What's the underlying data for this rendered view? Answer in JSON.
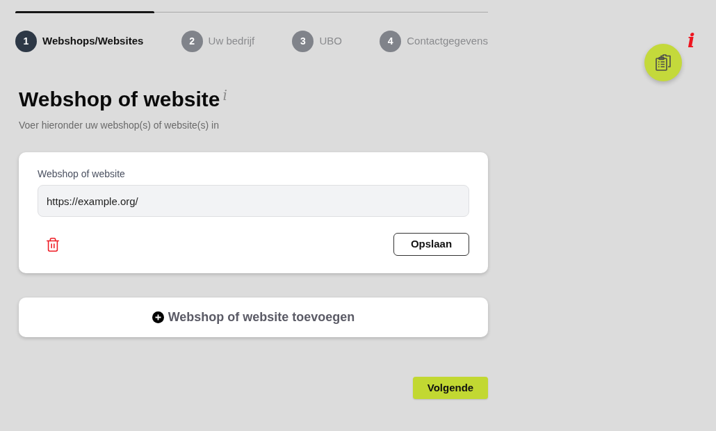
{
  "progress": {
    "level": 0.294
  },
  "steps": [
    {
      "number": "1",
      "label": "Webshops/Websites",
      "selected": true
    },
    {
      "number": "2",
      "label": "Uw bedrijf",
      "selected": false
    },
    {
      "number": "3",
      "label": "UBO",
      "selected": false
    },
    {
      "number": "4",
      "label": "Contactgegevens",
      "selected": false
    }
  ],
  "heading": {
    "title": "Webshop of website",
    "info_mark": "i",
    "subtitle": "Voer hieronder uw webshop(s) of website(s) in"
  },
  "entries": [
    {
      "label": "Webshop of website",
      "value": "https://example.org/",
      "save_button": "Opslaan"
    }
  ],
  "add_button": "Webshop of website toevoegen",
  "next_button": "Volgende",
  "help": {
    "info_mark": "i"
  }
}
